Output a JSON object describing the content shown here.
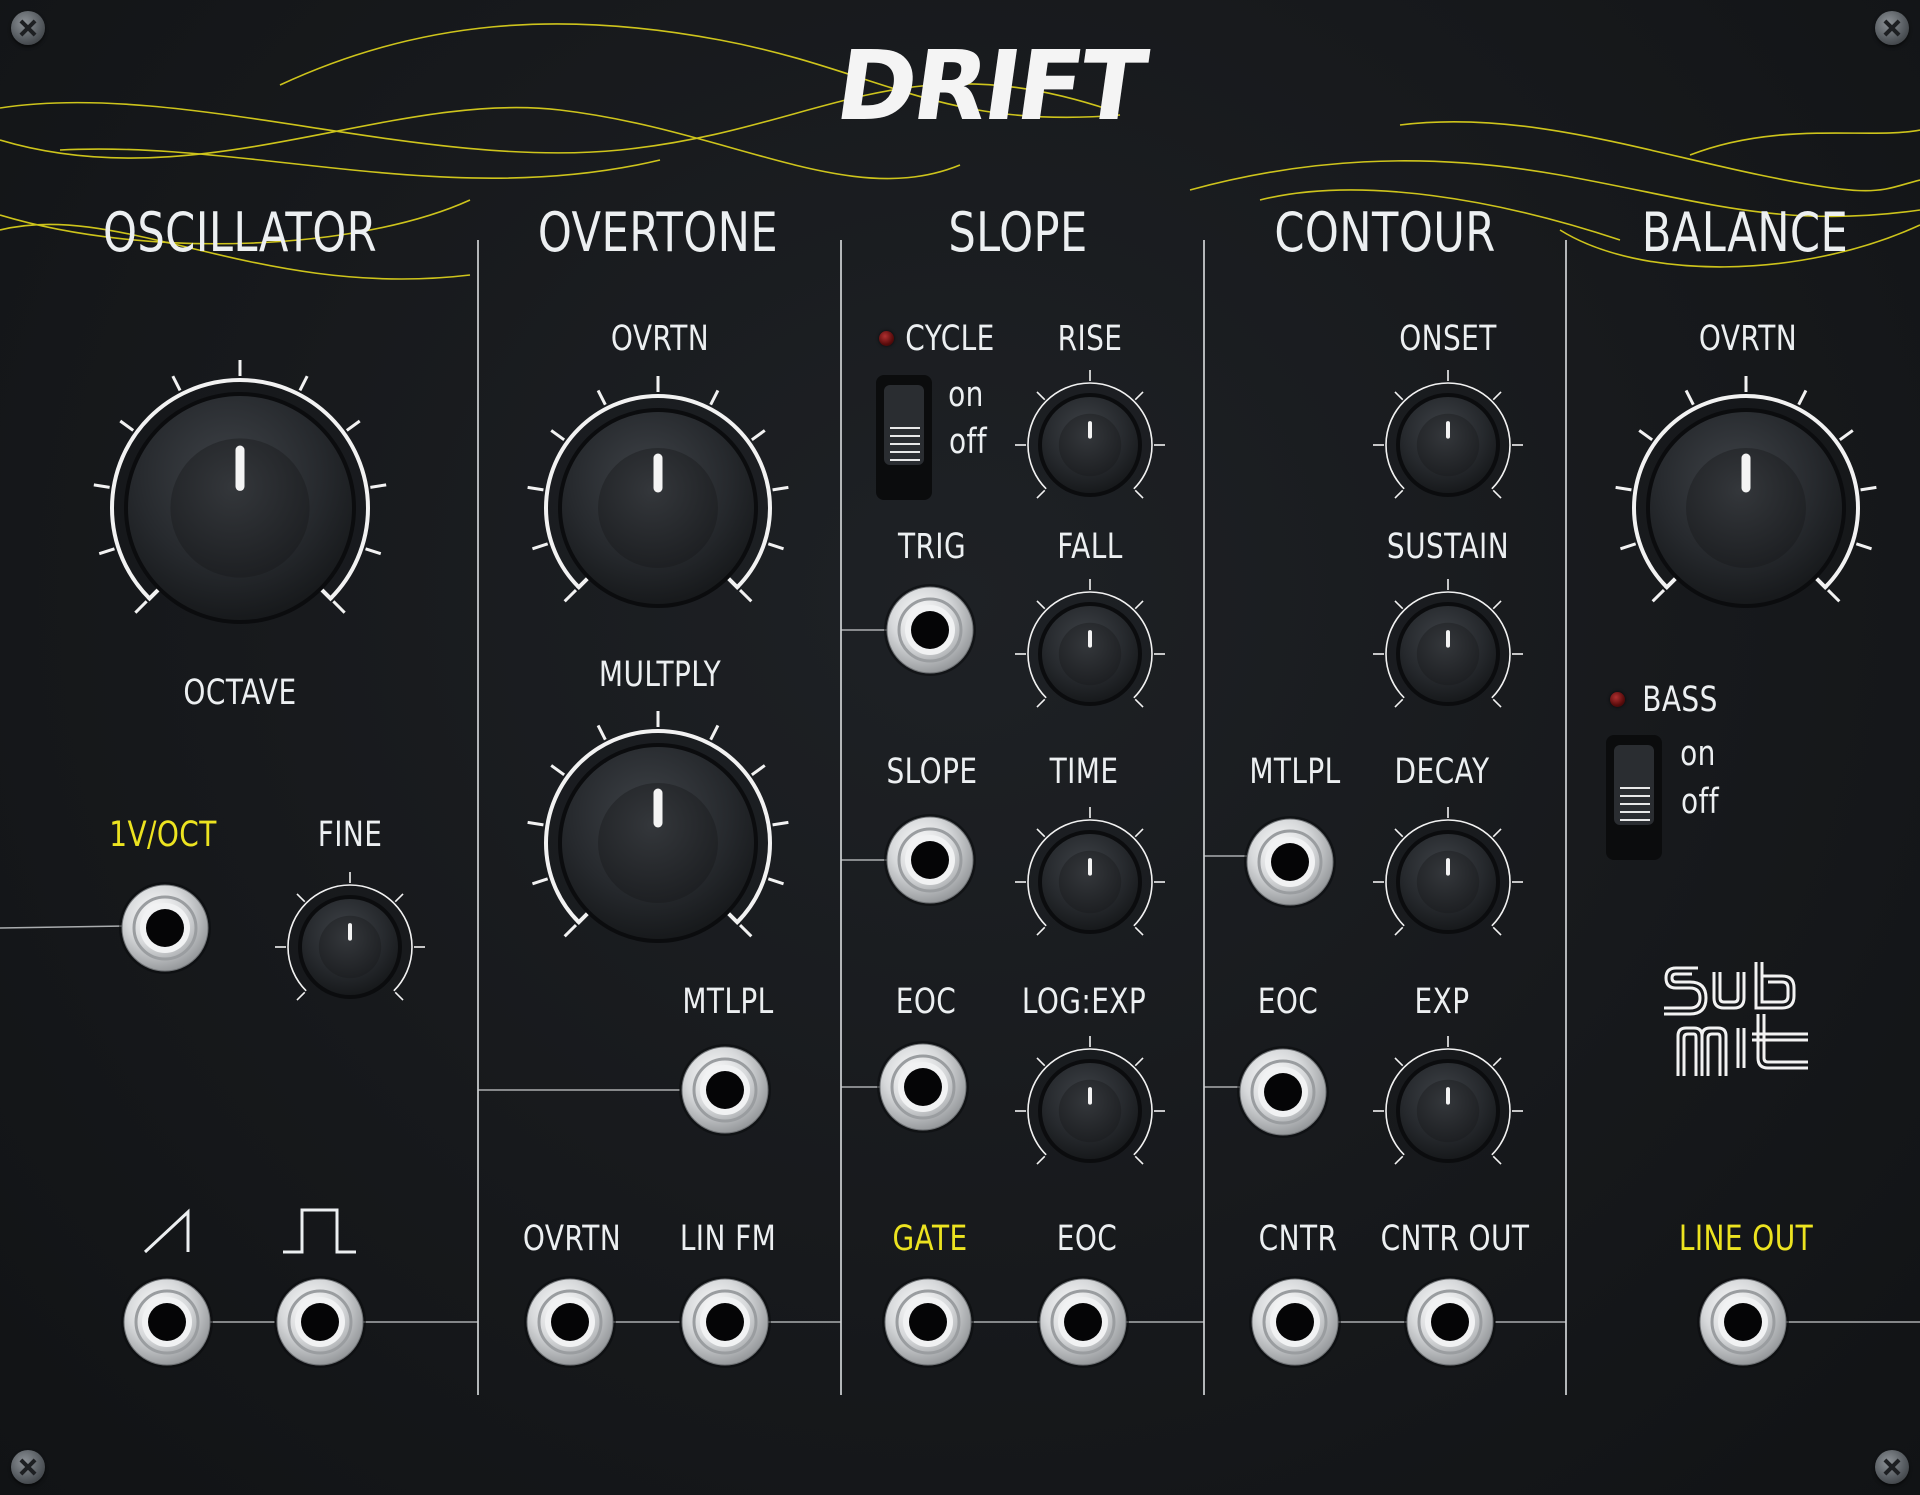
{
  "module": {
    "brand_title": "DRIFT",
    "logo": "submit-logo"
  },
  "colors": {
    "panel": "#17191c",
    "text": "#eceff1",
    "accent_yellow": "#ece320",
    "led_red": "#8a1a1a",
    "knob_ring": "#f2f2f2"
  },
  "sections": {
    "oscillator": {
      "title": "OSCILLATOR",
      "octave_label": "OCTAVE",
      "voct_label": "1V/OCT",
      "fine_label": "FINE",
      "saw_icon": "saw-wave-icon",
      "square_icon": "square-wave-icon"
    },
    "overtone": {
      "title": "OVERTONE",
      "ovrtn_label": "OVRTN",
      "multply_label": "MULTPLY",
      "mtlpl_label": "MTLPL",
      "ovrtn_out_label": "OVRTN",
      "linfm_label": "LIN FM"
    },
    "slope": {
      "title": "SLOPE",
      "cycle_label": "CYCLE",
      "switch_on": "on",
      "switch_off": "off",
      "rise_label": "RISE",
      "trig_label": "TRIG",
      "fall_label": "FALL",
      "slope_label": "SLOPE",
      "time_label": "TIME",
      "eoc_label": "EOC",
      "logexp_label": "LOG:EXP",
      "gate_label": "GATE",
      "eoc_out_label": "EOC"
    },
    "contour": {
      "title": "CONTOUR",
      "onset_label": "ONSET",
      "sustain_label": "SUSTAIN",
      "mtlpl_label": "MTLPL",
      "decay_label": "DECAY",
      "eoc_label": "EOC",
      "exp_label": "EXP",
      "cntr_label": "CNTR",
      "cntr_out_label": "CNTR OUT"
    },
    "balance": {
      "title": "BALANCE",
      "ovrtn_label": "OVRTN",
      "bass_label": "BASS",
      "switch_on": "on",
      "switch_off": "off",
      "line_out_label": "LINE OUT"
    }
  }
}
